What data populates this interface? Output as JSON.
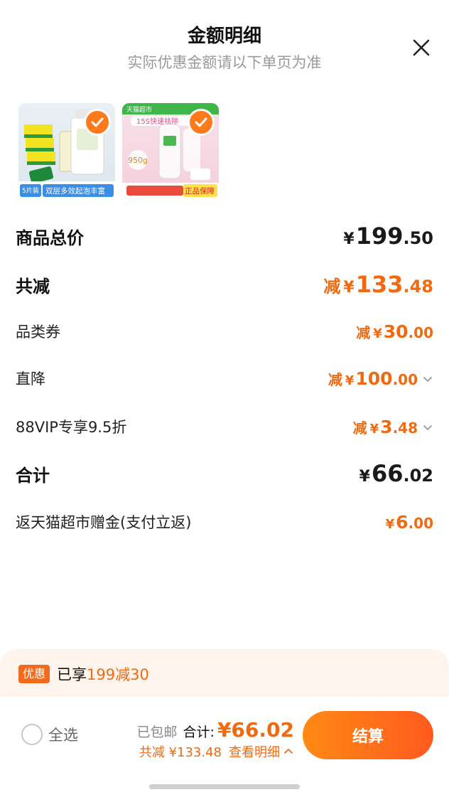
{
  "header": {
    "title": "金额明细",
    "subtitle": "实际优惠金额请以下单页为准"
  },
  "products": [
    {
      "badge": "5片装",
      "caption": "双层多效起泡丰富"
    },
    {
      "top_text": "天猫超市",
      "banner": "15S快速祛除",
      "weight": "950g",
      "footer": "正品保障"
    }
  ],
  "rows": {
    "subtotal": {
      "label": "商品总价",
      "currency": "¥",
      "integer": "199",
      "decimal": ".50"
    },
    "total_discount": {
      "label": "共减",
      "prefix": "减",
      "currency": "¥",
      "integer": "133",
      "decimal": ".48"
    },
    "category_coupon": {
      "label": "品类券",
      "prefix": "减",
      "currency": "¥",
      "integer": "30",
      "decimal": ".00"
    },
    "direct_cut": {
      "label": "直降",
      "prefix": "减",
      "currency": "¥",
      "integer": "100",
      "decimal": ".00"
    },
    "vip_discount": {
      "label": "88VIP专享9.5折",
      "prefix": "减",
      "currency": "¥",
      "integer": "3",
      "decimal": ".48"
    },
    "total": {
      "label": "合计",
      "currency": "¥",
      "integer": "66",
      "decimal": ".02"
    },
    "cashback": {
      "label": "返天猫超市赠金(支付立返)",
      "currency": "¥",
      "integer": "6",
      "decimal": ".00"
    }
  },
  "promo": {
    "badge": "优惠",
    "text_prefix": "已享",
    "text_highlight": "199减30"
  },
  "bottom_bar": {
    "select_all_label": "全选",
    "shipping": "已包邮",
    "total_label": "合计:",
    "total_value": "¥66.02",
    "saved_text": "共减 ¥133.48",
    "detail_label": "查看明细",
    "checkout_label": "结算"
  },
  "colors": {
    "accent": "#f06a12",
    "checkout_start": "#ff8a14",
    "checkout_end": "#ff5a1f",
    "promo_bg": "#fff4ec"
  }
}
